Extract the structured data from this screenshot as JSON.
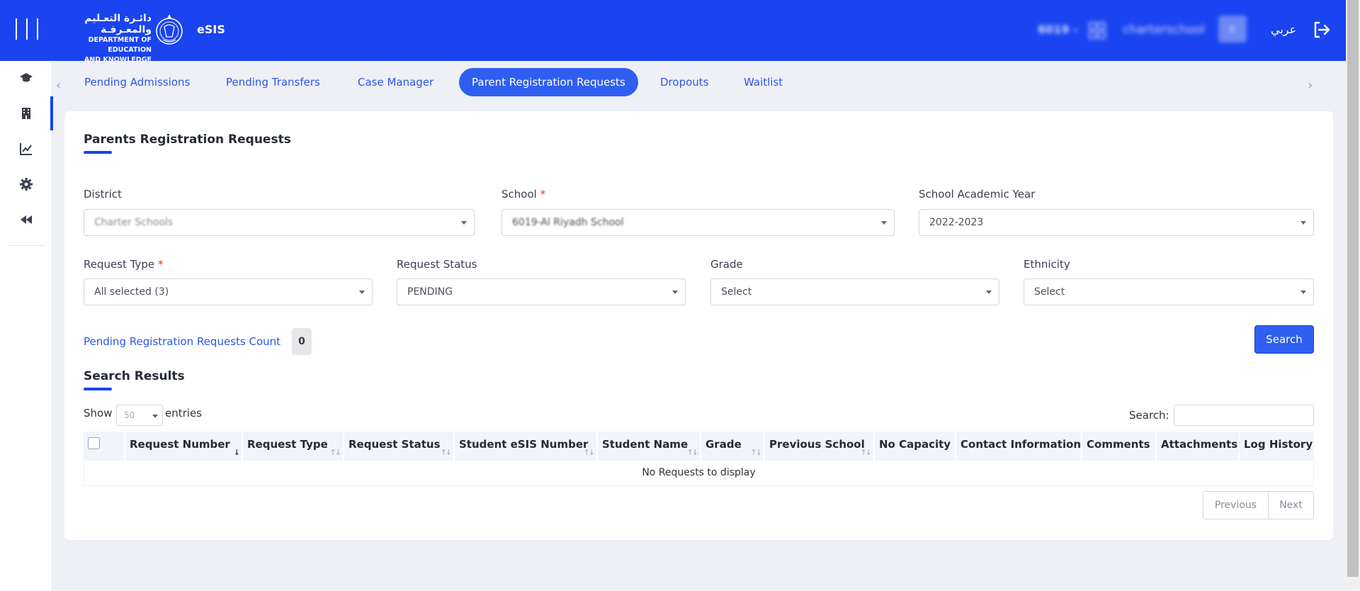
{
  "header": {
    "logo_arabic": "دائـرة التعـليم والمعـرفـة",
    "logo_line1": "DEPARTMENT OF EDUCATION",
    "logo_line2": "AND KNOWLEDGE",
    "app_name": "eSIS",
    "school_code": "6019 -",
    "username": "charterschool",
    "avatar_initial": "c",
    "language_toggle": "عربي"
  },
  "sidebar": {
    "items": [
      {
        "icon": "graduation-cap-icon"
      },
      {
        "icon": "building-icon",
        "active": true
      },
      {
        "icon": "chart-line-icon"
      },
      {
        "icon": "gear-icon"
      },
      {
        "icon": "double-chevron-left-icon"
      }
    ]
  },
  "tabs": [
    {
      "label": "Pending Admissions"
    },
    {
      "label": "Pending Transfers"
    },
    {
      "label": "Case Manager"
    },
    {
      "label": "Parent Registration Requests",
      "active": true
    },
    {
      "label": "Dropouts"
    },
    {
      "label": "Waitlist"
    }
  ],
  "page": {
    "title": "Parents Registration Requests",
    "filters": {
      "district": {
        "label": "District",
        "value": "Charter Schools"
      },
      "school": {
        "label": "School",
        "required_mark": "*",
        "value": "6019-Al Riyadh School"
      },
      "academic_year": {
        "label": "School Academic Year",
        "value": "2022-2023"
      },
      "request_type": {
        "label": "Request Type",
        "required_mark": "*",
        "value": "All selected (3)"
      },
      "request_status": {
        "label": "Request Status",
        "value": "PENDING"
      },
      "grade": {
        "label": "Grade",
        "value": "Select"
      },
      "ethnicity": {
        "label": "Ethnicity",
        "value": "Select"
      }
    },
    "pending_count_label": "Pending Registration Requests Count",
    "pending_count": "0",
    "search_button": "Search"
  },
  "results": {
    "title": "Search Results",
    "show_label": "Show",
    "page_size": "50",
    "entries_label": "entries",
    "search_label": "Search:",
    "columns": [
      "Request Number",
      "Request Type",
      "Request Status",
      "Student eSIS Number",
      "Student Name",
      "Grade",
      "Previous School",
      "No Capacity",
      "Contact Information",
      "Comments",
      "Attachments",
      "Log History"
    ],
    "empty_message": "No Requests to display",
    "previous": "Previous",
    "next": "Next"
  },
  "colors": {
    "brand": "#1a44f0",
    "accent": "#2f5ff0",
    "background": "#eef0f6"
  }
}
